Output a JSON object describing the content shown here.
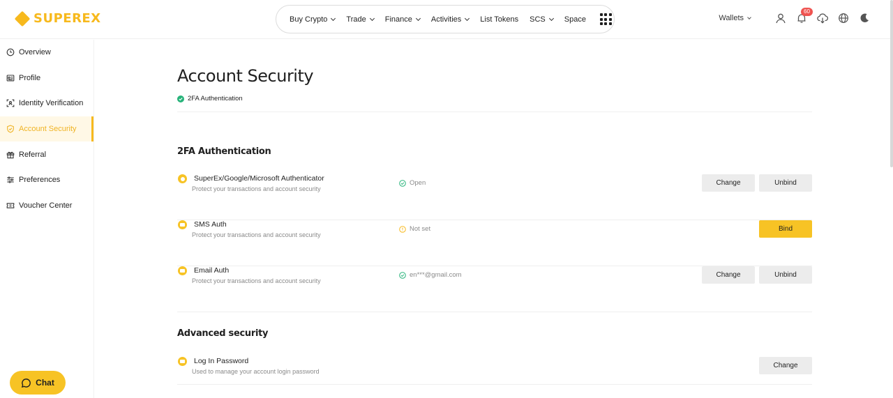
{
  "brand": {
    "name": "SUPEREX",
    "accent": "#f7b91d"
  },
  "topnav": {
    "items": [
      {
        "label": "Buy Crypto",
        "has_menu": true
      },
      {
        "label": "Trade",
        "has_menu": true
      },
      {
        "label": "Finance",
        "has_menu": true
      },
      {
        "label": "Activities",
        "has_menu": true
      },
      {
        "label": "List Tokens",
        "has_menu": false
      },
      {
        "label": "SCS",
        "has_menu": true
      },
      {
        "label": "Space",
        "has_menu": false
      }
    ],
    "apps_icon": "grid-icon"
  },
  "header_right": {
    "wallets_label": "Wallets",
    "notification_count": "60",
    "icons": [
      "user-icon",
      "bell-icon",
      "download-icon",
      "globe-icon",
      "moon-icon"
    ]
  },
  "sidebar": {
    "items": [
      {
        "label": "Overview",
        "icon": "clock-icon",
        "active": false
      },
      {
        "label": "Profile",
        "icon": "id-card-icon",
        "active": false
      },
      {
        "label": "Identity Verification",
        "icon": "face-scan-icon",
        "active": false
      },
      {
        "label": "Account Security",
        "icon": "shield-icon",
        "active": true
      },
      {
        "label": "Referral",
        "icon": "gift-icon",
        "active": false
      },
      {
        "label": "Preferences",
        "icon": "sliders-icon",
        "active": false
      },
      {
        "label": "Voucher Center",
        "icon": "ticket-icon",
        "active": false
      }
    ],
    "chat_label": "Chat"
  },
  "page": {
    "title": "Account Security",
    "crumb": "2FA Authentication"
  },
  "sections": {
    "twofa": {
      "title": "2FA Authentication",
      "rows": [
        {
          "name": "SuperEx/Google/Microsoft Authenticator",
          "desc": "Protect your transactions and account security",
          "status": "Open",
          "status_type": "ok",
          "buttons": [
            "Change",
            "Unbind"
          ]
        },
        {
          "name": "SMS Auth",
          "desc": "Protect your transactions and account security",
          "status": "Not set",
          "status_type": "warn",
          "buttons": [
            "Bind"
          ]
        },
        {
          "name": "Email Auth",
          "desc": "Protect your transactions and account security",
          "status": "en***@gmail.com",
          "status_type": "ok",
          "buttons": [
            "Change",
            "Unbind"
          ]
        }
      ]
    },
    "advanced": {
      "title": "Advanced security",
      "rows": [
        {
          "name": "Log In Password",
          "desc": "Used to manage your account login password",
          "buttons": [
            "Change"
          ]
        }
      ]
    }
  },
  "colors": {
    "ok": "#27b37a",
    "warn": "#f7b91d",
    "button_gray": "#ececec",
    "button_yellow": "#f7c325"
  }
}
